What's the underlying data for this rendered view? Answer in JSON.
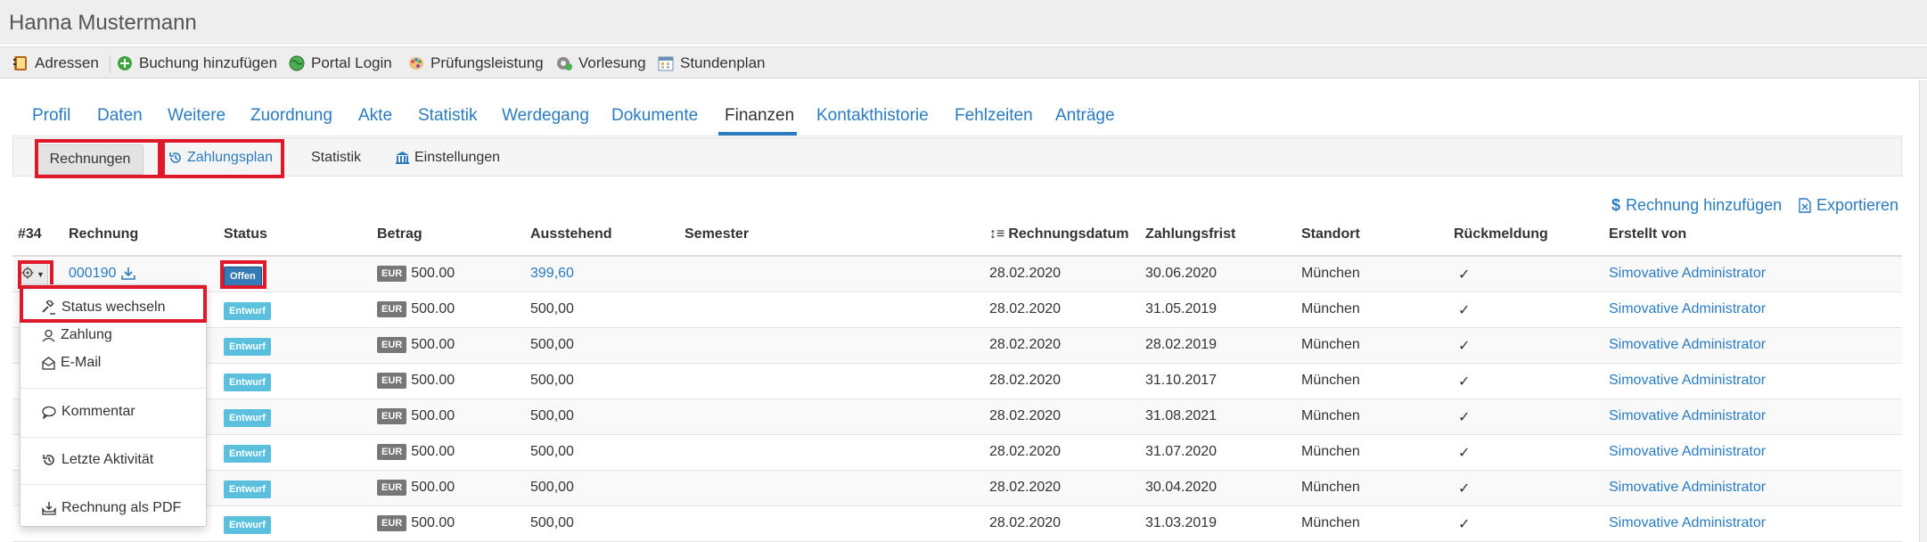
{
  "header": {
    "title": "Hanna Mustermann"
  },
  "toolbar": {
    "items": [
      {
        "label": "Adressen",
        "icon": "address-book-icon"
      },
      {
        "label": "Buchung hinzufügen",
        "icon": "add-circle-icon"
      },
      {
        "label": "Portal Login",
        "icon": "globe-icon"
      },
      {
        "label": "Prüfungsleistung",
        "icon": "palette-icon"
      },
      {
        "label": "Vorlesung",
        "icon": "gear-globe-icon"
      },
      {
        "label": "Stundenplan",
        "icon": "calendar-icon"
      }
    ]
  },
  "tabs": {
    "items": [
      "Profil",
      "Daten",
      "Weitere",
      "Zuordnung",
      "Akte",
      "Statistik",
      "Werdegang",
      "Dokumente",
      "Finanzen",
      "Kontakthistorie",
      "Fehlzeiten",
      "Anträge"
    ],
    "active": "Finanzen"
  },
  "subnav": {
    "rechnungen": "Rechnungen",
    "zahlungsplan": "Zahlungsplan",
    "statistik": "Statistik",
    "einstellungen": "Einstellungen"
  },
  "actions": {
    "add_invoice": "Rechnung hinzufügen",
    "export": "Exportieren"
  },
  "table": {
    "count_label": "#34",
    "headers": {
      "rechnung": "Rechnung",
      "status": "Status",
      "betrag": "Betrag",
      "ausstehend": "Ausstehend",
      "semester": "Semester",
      "rechnungsdatum": "Rechnungsdatum",
      "zahlungsfrist": "Zahlungsfrist",
      "standort": "Standort",
      "rueckmeldung": "Rückmeldung",
      "erstellt_von": "Erstellt von"
    },
    "currency": "EUR",
    "rows": [
      {
        "rechnung": "000190",
        "status": "Offen",
        "betrag": "500.00",
        "ausstehend": "399,60",
        "rechnungsdatum": "28.02.2020",
        "zahlungsfrist": "30.06.2020",
        "standort": "München",
        "rueckmeldung": "✓",
        "erstellt_von": "Simovative Administrator"
      },
      {
        "rechnung": "",
        "status": "Entwurf",
        "betrag": "500.00",
        "ausstehend": "500,00",
        "rechnungsdatum": "28.02.2020",
        "zahlungsfrist": "31.05.2019",
        "standort": "München",
        "rueckmeldung": "✓",
        "erstellt_von": "Simovative Administrator"
      },
      {
        "rechnung": "",
        "status": "Entwurf",
        "betrag": "500.00",
        "ausstehend": "500,00",
        "rechnungsdatum": "28.02.2020",
        "zahlungsfrist": "28.02.2019",
        "standort": "München",
        "rueckmeldung": "✓",
        "erstellt_von": "Simovative Administrator"
      },
      {
        "rechnung": "",
        "status": "Entwurf",
        "betrag": "500.00",
        "ausstehend": "500,00",
        "rechnungsdatum": "28.02.2020",
        "zahlungsfrist": "31.10.2017",
        "standort": "München",
        "rueckmeldung": "✓",
        "erstellt_von": "Simovative Administrator"
      },
      {
        "rechnung": "",
        "status": "Entwurf",
        "betrag": "500.00",
        "ausstehend": "500,00",
        "rechnungsdatum": "28.02.2020",
        "zahlungsfrist": "31.08.2021",
        "standort": "München",
        "rueckmeldung": "✓",
        "erstellt_von": "Simovative Administrator"
      },
      {
        "rechnung": "",
        "status": "Entwurf",
        "betrag": "500.00",
        "ausstehend": "500,00",
        "rechnungsdatum": "28.02.2020",
        "zahlungsfrist": "31.07.2020",
        "standort": "München",
        "rueckmeldung": "✓",
        "erstellt_von": "Simovative Administrator"
      },
      {
        "rechnung": "",
        "status": "Entwurf",
        "betrag": "500.00",
        "ausstehend": "500,00",
        "rechnungsdatum": "28.02.2020",
        "zahlungsfrist": "30.04.2020",
        "standort": "München",
        "rueckmeldung": "✓",
        "erstellt_von": "Simovative Administrator"
      },
      {
        "rechnung": "",
        "status": "Entwurf",
        "betrag": "500.00",
        "ausstehend": "500,00",
        "rechnungsdatum": "28.02.2020",
        "zahlungsfrist": "31.03.2019",
        "standort": "München",
        "rueckmeldung": "✓",
        "erstellt_von": "Simovative Administrator"
      }
    ]
  },
  "dropdown_menu": {
    "status_wechseln": "Status wechseln",
    "zahlung": "Zahlung",
    "email": "E-Mail",
    "kommentar": "Kommentar",
    "letzte_aktivitaet": "Letzte Aktivität",
    "rechnung_pdf": "Rechnung als PDF"
  },
  "colors": {
    "link": "#2b7bc0",
    "highlight": "#e0192a",
    "badge_offen": "#337ab7",
    "badge_entwurf": "#5bc0de",
    "currency_badge": "#777777"
  }
}
